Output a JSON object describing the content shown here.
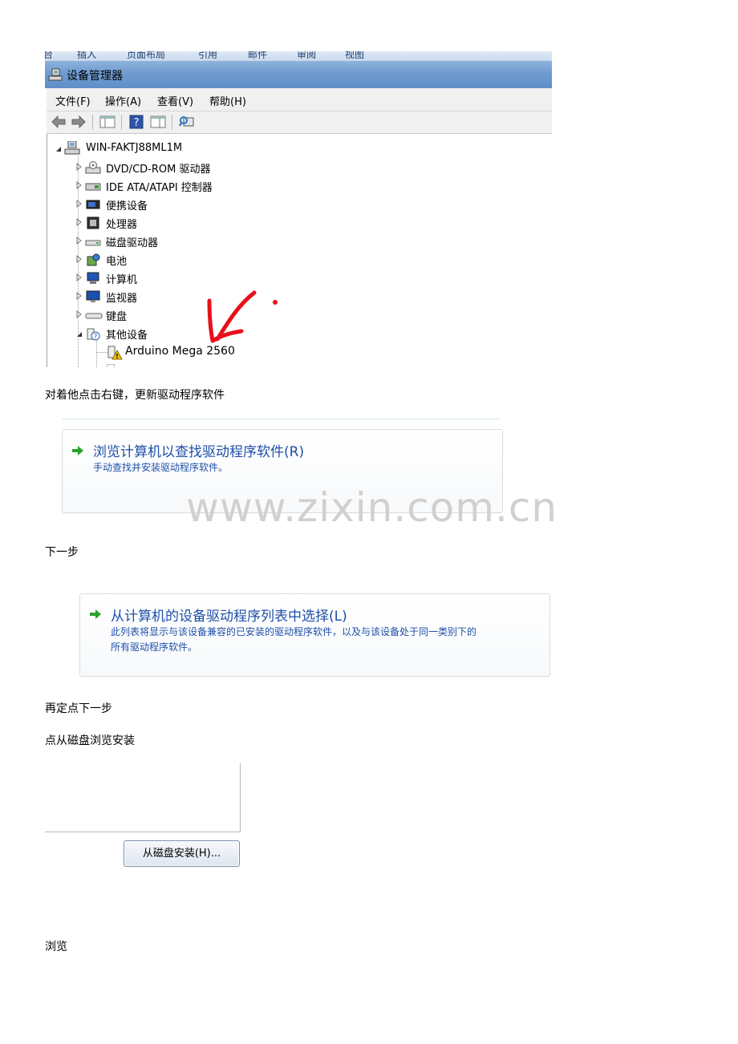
{
  "ribbon": {
    "tabs": [
      "台",
      "插入",
      "页面布局",
      "引用",
      "邮件",
      "审阅",
      "视图"
    ]
  },
  "window": {
    "title": "设备管理器"
  },
  "menu": {
    "items": [
      "文件(F)",
      "操作(A)",
      "查看(V)",
      "帮助(H)"
    ]
  },
  "tree": {
    "root": "WIN-FAKTJ88ML1M",
    "categories": [
      {
        "label": "DVD/CD-ROM 驱动器",
        "icon": "dvd-drive-icon"
      },
      {
        "label": "IDE ATA/ATAPI 控制器",
        "icon": "ide-controller-icon"
      },
      {
        "label": "便携设备",
        "icon": "portable-device-icon"
      },
      {
        "label": "处理器",
        "icon": "processor-icon"
      },
      {
        "label": "磁盘驱动器",
        "icon": "disk-drive-icon"
      },
      {
        "label": "电池",
        "icon": "battery-icon"
      },
      {
        "label": "计算机",
        "icon": "computer-icon"
      },
      {
        "label": "监视器",
        "icon": "monitor-icon"
      },
      {
        "label": "键盘",
        "icon": "keyboard-icon"
      },
      {
        "label": "其他设备",
        "icon": "other-device-icon"
      }
    ],
    "child": "Arduino Mega 2560"
  },
  "captions": {
    "c1": "对着他点击右键，更新驱动程序软件",
    "c2": "下一步",
    "c3": "再定点下一步",
    "c4": "点从磁盘浏览安装",
    "c5": "浏览"
  },
  "option1": {
    "title": "浏览计算机以查找驱动程序软件(R)",
    "desc": "手动查找并安装驱动程序软件。"
  },
  "option2": {
    "title": "从计算机的设备驱动程序列表中选择(L)",
    "desc_line1": "此列表将显示与该设备兼容的已安装的驱动程序软件，以及与该设备处于同一类别下的",
    "desc_line2": "所有驱动程序软件。"
  },
  "watermark": "www.zixin.com.cn",
  "disk_button": {
    "label": "从磁盘安装(H)..."
  },
  "colors": {
    "link_blue": "#1e4fa8",
    "arrow_green": "#2aa12a",
    "annotation_red": "#e8101a"
  }
}
